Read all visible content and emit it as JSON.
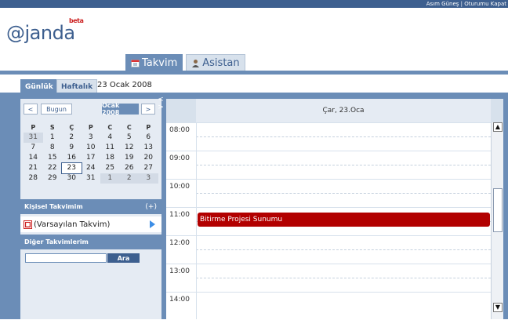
{
  "topbar": {
    "user": "Asım Güneş",
    "separator": "|",
    "logout": "Oturumu Kapat"
  },
  "logo": {
    "text": "@janda",
    "beta": "beta"
  },
  "nav": {
    "tabs": [
      {
        "label": "Takvim",
        "icon": "calendar-icon"
      },
      {
        "label": "Asistan",
        "icon": "person-icon"
      }
    ]
  },
  "subnav": {
    "daily": "Günlük",
    "weekly": "Haftalık",
    "date": "23 Ocak 2008"
  },
  "minical": {
    "prev": "<",
    "today": "Bugun",
    "month": "Ocak 2008",
    "next": ">",
    "dow": [
      "P",
      "S",
      "Ç",
      "P",
      "C",
      "C",
      "P"
    ],
    "weeks": [
      [
        "31",
        "1",
        "2",
        "3",
        "4",
        "5",
        "6"
      ],
      [
        "7",
        "8",
        "9",
        "10",
        "11",
        "12",
        "13"
      ],
      [
        "14",
        "15",
        "16",
        "17",
        "18",
        "19",
        "20"
      ],
      [
        "21",
        "22",
        "23",
        "24",
        "25",
        "26",
        "27"
      ],
      [
        "28",
        "29",
        "30",
        "31",
        "1",
        "2",
        "3"
      ]
    ],
    "selected": "23"
  },
  "sidebar": {
    "personal_title": "Kişisel Takvimim",
    "add": "(+)",
    "default_calendar": "(Varsayılan Takvim)",
    "other_title": "Diğer Takvimlerim",
    "search_button": "Ara",
    "search_value": ""
  },
  "collapse": {
    "left": "<",
    "right": ">"
  },
  "dayview": {
    "header": "Çar, 23.Oca",
    "hours": [
      "08:00",
      "09:00",
      "10:00",
      "11:00",
      "12:00",
      "13:00",
      "14:00"
    ],
    "event": "Bitirme Projesi Sunumu"
  },
  "colors": {
    "brand": "#3d5f8f",
    "accent": "#6b8db7",
    "event": "#b20000"
  }
}
